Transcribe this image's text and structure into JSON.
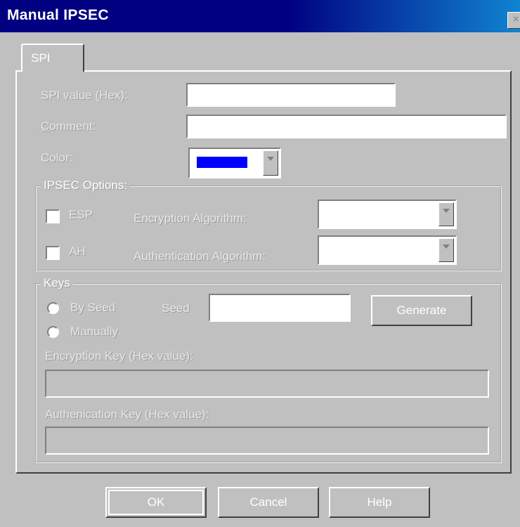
{
  "window": {
    "title": "Manual IPSEC",
    "close_glyph": "×"
  },
  "tab": {
    "label": "SPI"
  },
  "spi": {
    "value_label": "SPI value (Hex):",
    "value": "",
    "comment_label_mnemonic": "C",
    "comment_label_rest": "omment:",
    "comment_value": "",
    "color_label": "Color:",
    "color_value": "#0000ff"
  },
  "ipsec_options": {
    "title": "IPSEC Options:",
    "esp_label": "ESP",
    "ah_label": "AH",
    "enc_algo_label": "Encryption Algorithm:",
    "enc_algo_value": "",
    "auth_algo_label": "Authentication Algorithm:",
    "auth_algo_value": ""
  },
  "keys": {
    "title": "Keys",
    "by_seed_label": "By Seed",
    "manually_label": "Manually",
    "seed_label": "Seed",
    "seed_value": "",
    "generate_label": "Generate",
    "enc_key_label": "Encryption Key (Hex value):",
    "enc_key_value": "",
    "auth_key_label": "Authenication Key (Hex value):",
    "auth_key_value": ""
  },
  "footer": {
    "ok": "OK",
    "cancel": "Cancel",
    "help": "Help"
  }
}
